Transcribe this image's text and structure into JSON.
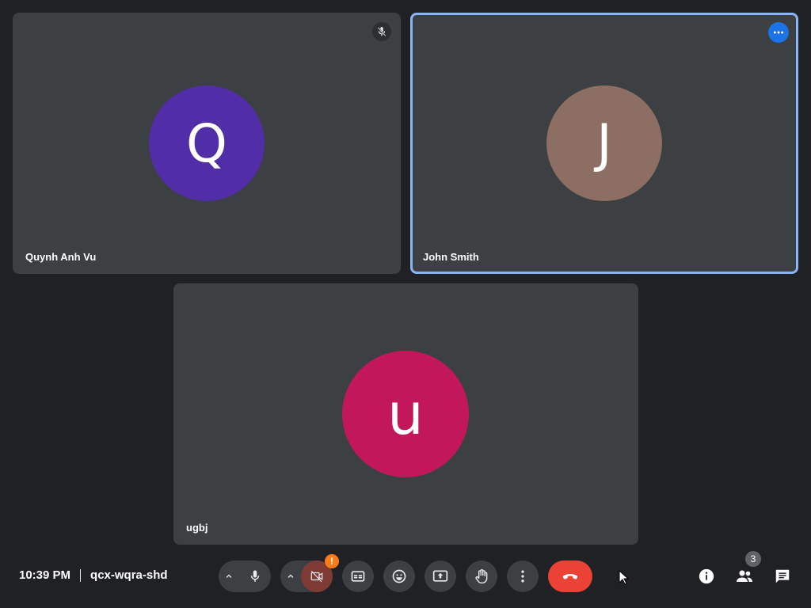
{
  "participants": [
    {
      "initial": "Q",
      "name": "Quynh Anh Vu",
      "avatar_color": "#512da8",
      "muted": true
    },
    {
      "initial": "J",
      "name": "John Smith",
      "avatar_color": "#8d6e63",
      "active": true
    },
    {
      "initial": "u",
      "name": "ugbj",
      "avatar_color": "#c2185b"
    }
  ],
  "bottom_bar": {
    "time": "10:39 PM",
    "meeting_code": "qcx-wqra-shd",
    "camera_warning": "!",
    "people_count": "3"
  },
  "colors": {
    "background": "#202124",
    "tile": "#3c4043",
    "active_border": "#8ab4f8",
    "end_call": "#ea4335",
    "warning": "#fa7b17",
    "more_button": "#1a73e8"
  },
  "icons": {
    "tile_1_indicator": "mic-off-icon",
    "tile_2_indicator": "more-horiz-icon",
    "controls": [
      "mic-icon",
      "camera-off-icon",
      "closed-captions-icon",
      "emoji-icon",
      "present-screen-icon",
      "raise-hand-icon",
      "more-vert-icon",
      "call-end-icon"
    ],
    "side": [
      "info-icon",
      "people-icon",
      "chat-icon"
    ]
  }
}
